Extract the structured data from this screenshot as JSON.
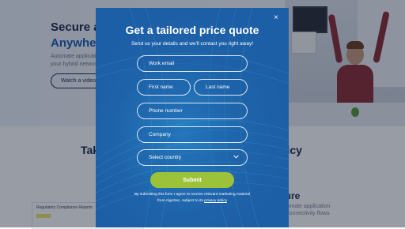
{
  "background_page": {
    "hero_title_line1": "Secure app",
    "hero_title_line2": "Anywhere",
    "hero_text_line1": "Automate applicati",
    "hero_text_line2": "your hybrid networ",
    "watch_video_label": "Watch a video",
    "section_heading_left": "Tak",
    "section_heading_right": "olicy",
    "subheading_right": "cture",
    "small_text_1": "Automate application",
    "small_text_2": "for connectivity flows",
    "doc_preview_title": "Regulatory Compliance Reports"
  },
  "modal": {
    "close_label": "×",
    "title": "Get a tailored price quote",
    "subtitle": "Send us your details and we'll contact you right away!",
    "fields": {
      "work_email_placeholder": "Work email",
      "first_name_placeholder": "First name",
      "last_name_placeholder": "Last name",
      "phone_placeholder": "Phone number",
      "company_placeholder": "Company",
      "country_selected": "Select country"
    },
    "submit_label": "Submit",
    "consent_line1": "By submitting this form I agree to receive relevant marketing material",
    "consent_line2_prefix": "from AlgoSec, subject to its ",
    "consent_link": "privacy policy",
    "chevron_icon": "chevron-down-icon",
    "colors": {
      "modal_bg": "#1d5fa6",
      "submit_bg": "#9cc23a"
    }
  }
}
